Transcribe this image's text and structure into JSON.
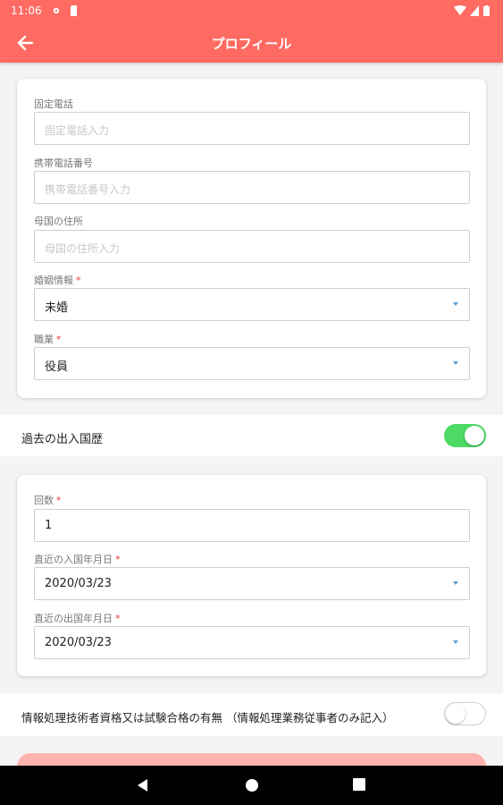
{
  "status": {
    "time": "11:06"
  },
  "header": {
    "title": "プロフィール"
  },
  "card1": {
    "landline": {
      "label": "固定電話",
      "placeholder": "固定電話入力"
    },
    "mobile": {
      "label": "携帯電話番号",
      "placeholder": "携帯電話番号入力"
    },
    "home_address": {
      "label": "母国の住所",
      "placeholder": "母国の住所入力"
    },
    "marital": {
      "label": "婚姻情報",
      "required_mark": "*",
      "value": "未婚"
    },
    "occupation": {
      "label": "職業",
      "required_mark": "*",
      "value": "役員"
    }
  },
  "travel_history": {
    "label": "過去の出入国歴",
    "toggle_on": true
  },
  "card2": {
    "count": {
      "label": "回数",
      "required_mark": "*",
      "value": "1"
    },
    "last_entry": {
      "label": "直近の入国年月日",
      "required_mark": "*",
      "value": "2020/03/23"
    },
    "last_exit": {
      "label": "直近の出国年月日",
      "required_mark": "*",
      "value": "2020/03/23"
    }
  },
  "it_qualification": {
    "label": "情報処理技術者資格又は試験合格の有無 （情報処理業務従事者のみ記入）",
    "toggle_on": false
  },
  "colors": {
    "accent": "#ff6b63",
    "toggle_on": "#4cd964",
    "required": "#e53935"
  }
}
